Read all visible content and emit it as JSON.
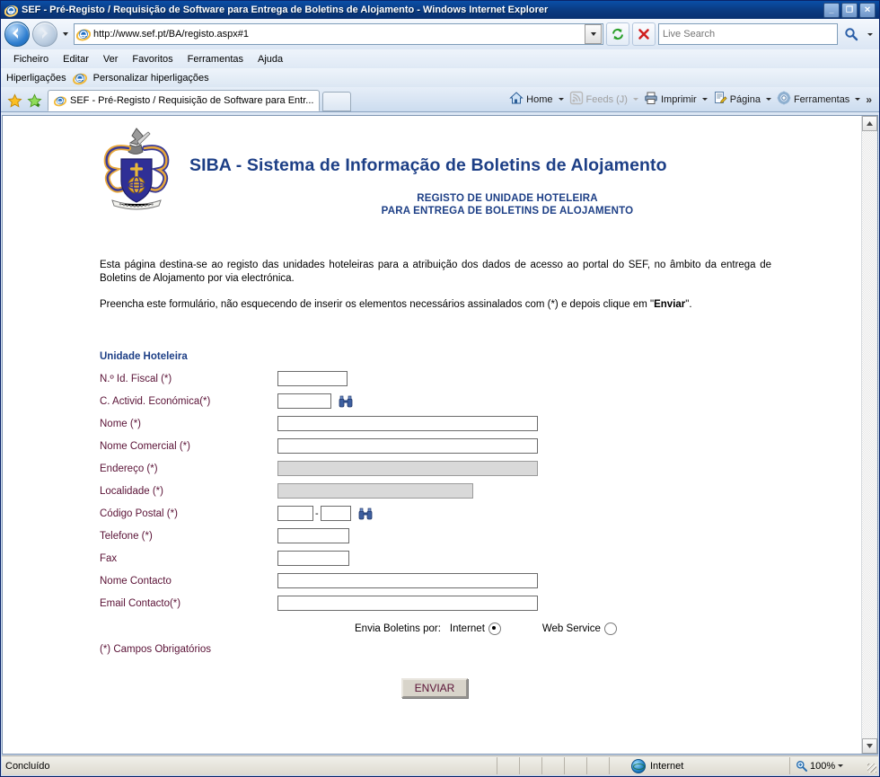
{
  "window": {
    "title": "SEF - Pré-Registo / Requisição de Software para Entrega de Boletins de Alojamento - Windows Internet Explorer",
    "minimize_label": "_",
    "maximize_label": "❐",
    "close_label": "✕"
  },
  "nav": {
    "back_name": "back-button",
    "forward_name": "forward-button",
    "url": "http://www.sef.pt/BA/registo.aspx#1",
    "refresh_label": "Actualizar",
    "stop_label": "Parar",
    "search_placeholder": "Live Search",
    "search_value": ""
  },
  "menubar": {
    "items": [
      "Ficheiro",
      "Editar",
      "Ver",
      "Favoritos",
      "Ferramentas",
      "Ajuda"
    ]
  },
  "linksbar": {
    "label": "Hiperligações",
    "link": "Personalizar hiperligações"
  },
  "tabs": {
    "items": [
      {
        "label": "SEF - Pré-Registo / Requisição de Software para Entr..."
      }
    ],
    "new_tab_label": ""
  },
  "commandbar": {
    "home": "Home",
    "feeds": "Feeds (J)",
    "print": "Imprimir",
    "page": "Página",
    "tools": "Ferramentas",
    "overflow": "»"
  },
  "content": {
    "title": "SIBA - Sistema de Informação de Boletins de Alojamento",
    "subtitle_line1": "REGISTO DE UNIDADE HOTELEIRA",
    "subtitle_line2": "PARA ENTREGA DE BOLETINS DE ALOJAMENTO",
    "paragraph1": "Esta página destina-se ao registo das unidades hoteleiras para a atribuição dos dados de acesso ao portal do SEF, no âmbito da entrega de Boletins de Alojamento por via electrónica.",
    "paragraph2_pre": "Preencha este formulário, não esquecendo de inserir os elementos necessários assinalados com (*) e depois clique em \"",
    "paragraph2_bold": "Enviar",
    "paragraph2_post": "\".",
    "group_title": "Unidade Hoteleira",
    "fields": [
      {
        "label": "N.º Id. Fiscal (*)",
        "value": "",
        "width": "w-fiscal",
        "disabled": false,
        "lookup": false
      },
      {
        "label": "C. Activid. Económica(*)",
        "value": "",
        "width": "w-cae",
        "disabled": false,
        "lookup": true
      },
      {
        "label": "Nome (*)",
        "value": "",
        "width": "w-wide",
        "disabled": false,
        "lookup": false
      },
      {
        "label": "Nome Comercial (*)",
        "value": "",
        "width": "w-wide",
        "disabled": false,
        "lookup": false
      },
      {
        "label": "Endereço (*)",
        "value": "",
        "width": "w-wide",
        "disabled": true,
        "lookup": false
      },
      {
        "label": "Localidade (*)",
        "value": "",
        "width": "w-local",
        "disabled": true,
        "lookup": false
      },
      {
        "label": "Telefone (*)",
        "value": "",
        "width": "w-tel",
        "disabled": false,
        "lookup": false
      },
      {
        "label": "Fax",
        "value": "",
        "width": "w-tel",
        "disabled": false,
        "lookup": false
      },
      {
        "label": "Nome Contacto",
        "value": "",
        "width": "w-wide",
        "disabled": false,
        "lookup": false
      },
      {
        "label": "Email Contacto(*)",
        "value": "",
        "width": "w-wide",
        "disabled": false,
        "lookup": false
      }
    ],
    "postal": {
      "label": "Código Postal (*)",
      "part1": "",
      "part2": "",
      "separator": "-"
    },
    "delivery": {
      "label": "Envia Boletins por:",
      "options": [
        {
          "label": "Internet",
          "selected": true
        },
        {
          "label": "Web Service",
          "selected": false
        }
      ]
    },
    "required_note": "(*) Campos Obrigatórios",
    "submit_label": "ENVIAR",
    "accent_blue": "#1d3f86",
    "label_maroon": "#5a1236"
  },
  "statusbar": {
    "status": "Concluído",
    "zone": "Internet",
    "zoom": "100%"
  }
}
